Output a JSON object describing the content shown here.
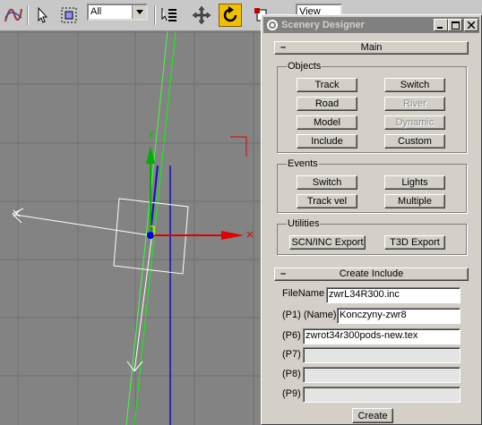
{
  "toolbar": {
    "selection_filter": "All",
    "view_dropdown": "View"
  },
  "panel": {
    "title": "Scenery Designer",
    "main_rollout": "Main",
    "objects": {
      "label": "Objects",
      "buttons": [
        "Track",
        "Switch",
        "Road",
        "River",
        "Model",
        "Dynamic",
        "Include",
        "Custom"
      ]
    },
    "events": {
      "label": "Events",
      "buttons": [
        "Switch",
        "Lights",
        "Track vel",
        "Multiple"
      ]
    },
    "utilities": {
      "label": "Utilities",
      "buttons": [
        "SCN/INC Export",
        "T3D Export"
      ]
    },
    "create_include": {
      "rollout": "Create Include",
      "fields": [
        {
          "label": "FileName",
          "value": "zwrL34R300.inc"
        },
        {
          "label": "(P1) (Name)",
          "value": "Konczyny-zwr8"
        },
        {
          "label": "(P6)",
          "value": "zwrot34r300pods-new.tex"
        },
        {
          "label": "(P7)",
          "value": ""
        },
        {
          "label": "(P8)",
          "value": ""
        },
        {
          "label": "(P9)",
          "value": ""
        }
      ],
      "create_button": "Create"
    }
  },
  "viewport": {
    "gizmo_y_label": "y",
    "colors": {
      "grid": "#6f6f6f",
      "x_axis": "#e00000",
      "y_axis": "#00b000",
      "spline_green": "#00ff00",
      "spline_blue": "#1010c0"
    }
  }
}
